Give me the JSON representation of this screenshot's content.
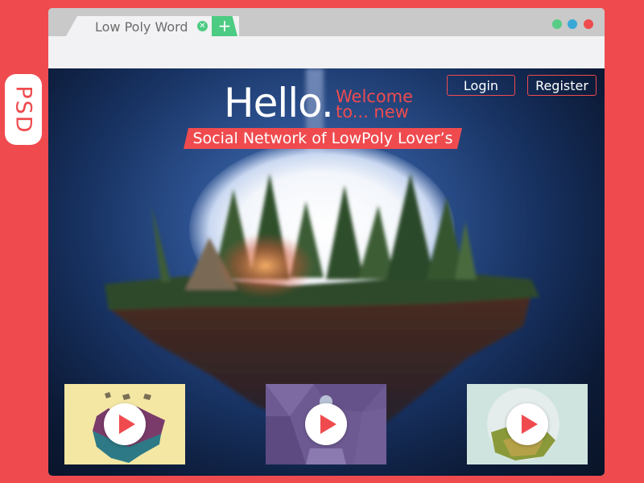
{
  "badge": {
    "label": "PSD"
  },
  "browser": {
    "tab_title": "Low Poly Word",
    "tab_close_glyph": "✕",
    "new_tab_glyph": "+",
    "window_controls": [
      "green",
      "blue",
      "red"
    ],
    "colors": {
      "green": "#56cc85",
      "blue": "#3aa8d6",
      "red": "#ef4b4f"
    }
  },
  "header": {
    "login_label": "Login",
    "register_label": "Register"
  },
  "hero": {
    "hello": "Hello.",
    "welcome_line1": "Welcome",
    "welcome_line2": "to... new",
    "tagline": "Social Network of LowPoly Lover’s"
  },
  "videos": [
    {
      "name": "video-thumbnail-1",
      "icon": "play-icon"
    },
    {
      "name": "video-thumbnail-2",
      "icon": "play-icon"
    },
    {
      "name": "video-thumbnail-3",
      "icon": "play-icon"
    }
  ],
  "theme": {
    "accent": "#ef4b4f",
    "tab_green": "#4ccb83",
    "background": "#ef4b4f"
  }
}
